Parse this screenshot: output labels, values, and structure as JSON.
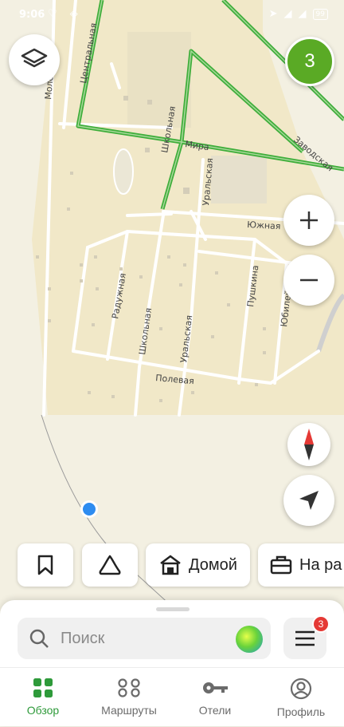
{
  "status_bar": {
    "time": "9:06",
    "battery": "99"
  },
  "map": {
    "traffic_level": "3",
    "streets": {
      "central": "Центральная",
      "mira": "Мира",
      "zavodskaya": "Заводская",
      "shkolnaya_1": "Школьная",
      "shkolnaya_2": "Школьная",
      "uralskaya_1": "Уральская",
      "uralskaya_2": "Уральская",
      "yuzhnaya": "Южная",
      "raduzhnaya": "Радужная",
      "pushkina": "Пушкина",
      "yubileynaya": "Юбилей",
      "polevaya": "Полевая",
      "molodezhnaya": "Моло"
    },
    "colors": {
      "road_green": "#3fae3b",
      "location_dot": "#2d8cf0",
      "compass_red": "#e53935"
    }
  },
  "controls": {
    "layers_icon": "layers-icon",
    "zoom_in_icon": "plus-icon",
    "zoom_out_icon": "minus-icon",
    "compass_icon": "compass-icon",
    "locate_icon": "navigation-arrow-icon"
  },
  "chips": [
    {
      "icon": "bookmark-icon",
      "label": ""
    },
    {
      "icon": "alice-icon",
      "label": ""
    },
    {
      "icon": "home-icon",
      "label": "Домой"
    },
    {
      "icon": "briefcase-icon",
      "label": "На ра"
    }
  ],
  "search": {
    "placeholder": "Поиск"
  },
  "menu_badge": "3",
  "tabs": [
    {
      "label": "Обзор",
      "icon": "grid-icon",
      "active": true
    },
    {
      "label": "Маршруты",
      "icon": "routes-icon",
      "active": false
    },
    {
      "label": "Отели",
      "icon": "key-icon",
      "active": false
    },
    {
      "label": "Профиль",
      "icon": "profile-icon",
      "active": false
    }
  ]
}
